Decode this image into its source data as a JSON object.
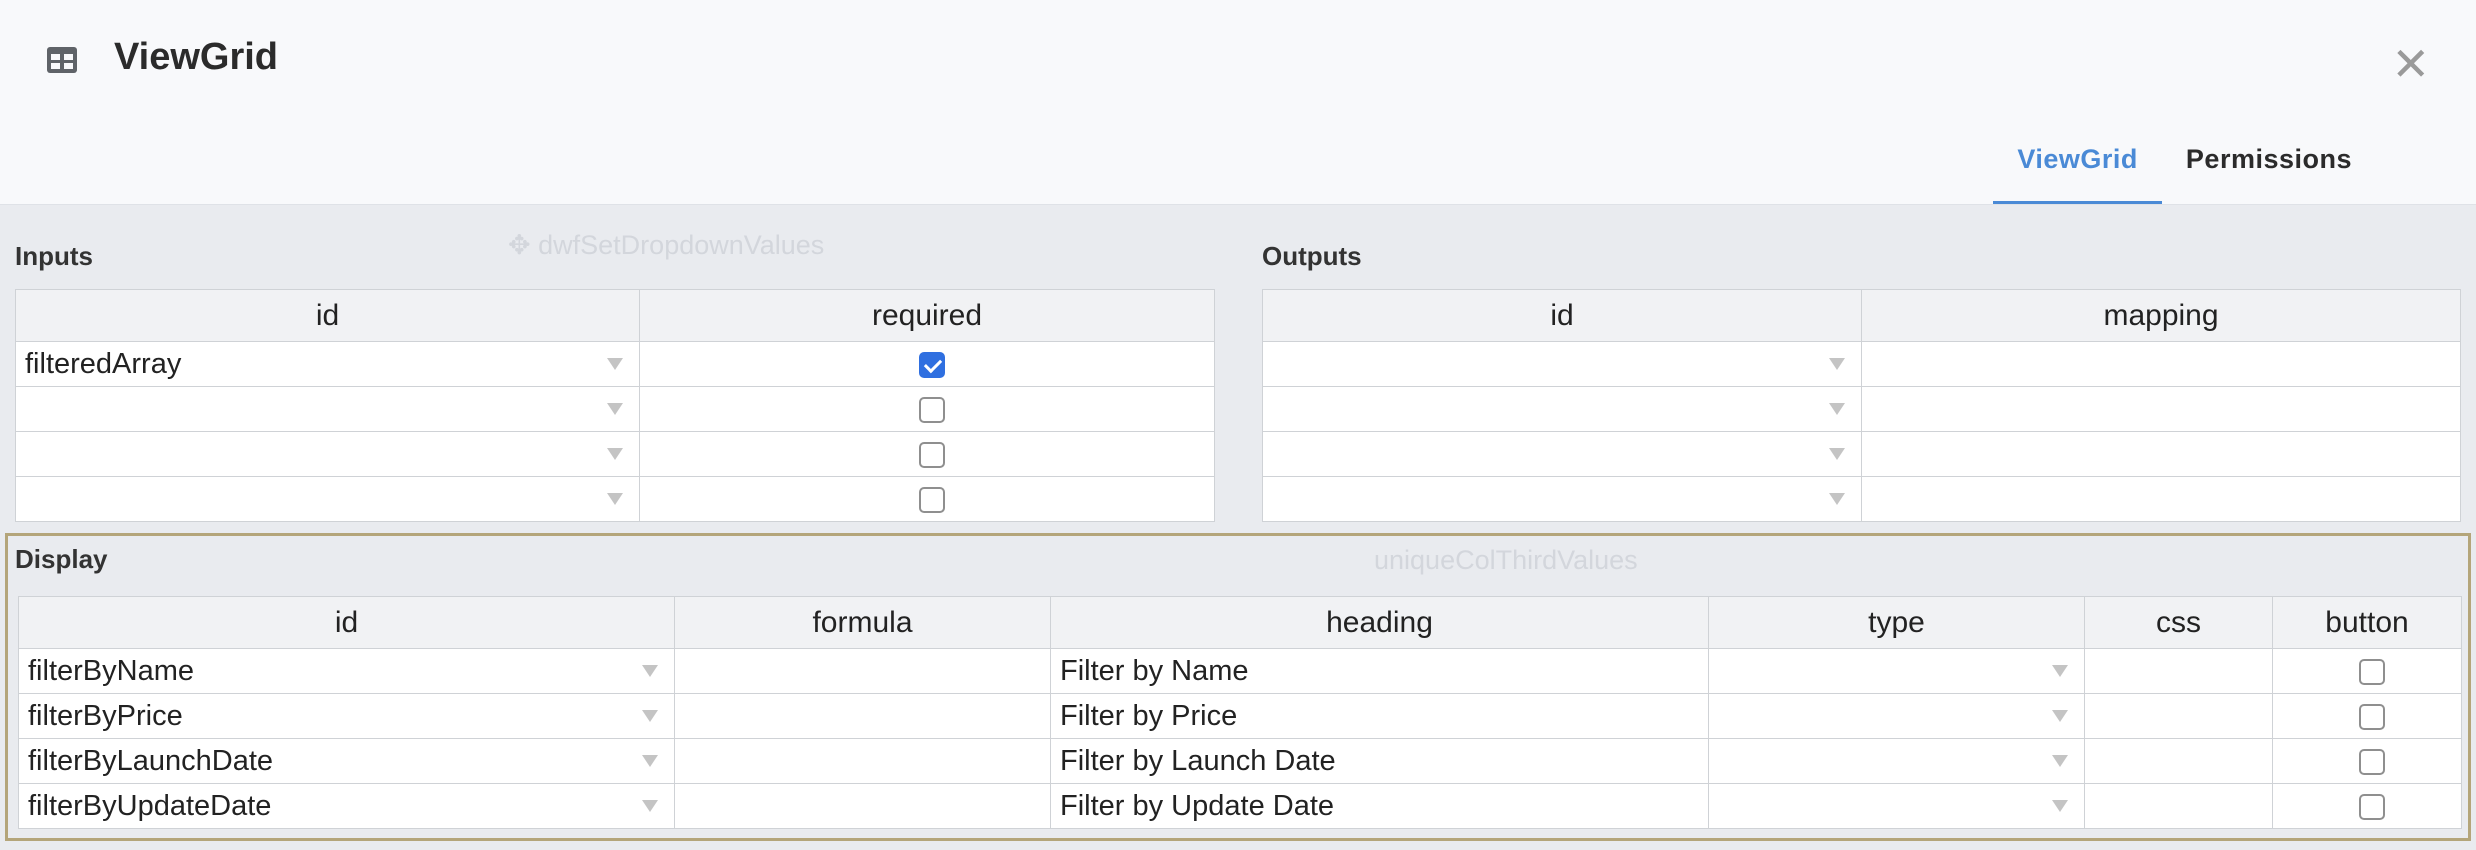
{
  "header": {
    "title": "ViewGrid",
    "title_icon": "table-icon",
    "close_icon": "close-icon",
    "close_glyph": "✕",
    "tabs": [
      {
        "label": "ViewGrid",
        "active": true
      },
      {
        "label": "Permissions",
        "active": false
      }
    ]
  },
  "background_canvas": {
    "node_1": "dwfSetDropdownValues",
    "node_2": "uniqueColThirdValues"
  },
  "inputs": {
    "label": "Inputs",
    "columns": [
      "id",
      "required"
    ],
    "rows": [
      {
        "id": "filteredArray",
        "required": true
      },
      {
        "id": "",
        "required": false
      },
      {
        "id": "",
        "required": false
      },
      {
        "id": "",
        "required": false
      }
    ]
  },
  "outputs": {
    "label": "Outputs",
    "columns": [
      "id",
      "mapping"
    ],
    "rows": [
      {
        "id": "",
        "mapping": ""
      },
      {
        "id": "",
        "mapping": ""
      },
      {
        "id": "",
        "mapping": ""
      },
      {
        "id": "",
        "mapping": ""
      }
    ]
  },
  "display": {
    "label": "Display",
    "columns": [
      "id",
      "formula",
      "heading",
      "type",
      "css",
      "button"
    ],
    "rows": [
      {
        "id": "filterByName",
        "formula": "",
        "heading": "Filter by Name",
        "type": "",
        "css": "",
        "button": false
      },
      {
        "id": "filterByPrice",
        "formula": "",
        "heading": "Filter by Price",
        "type": "",
        "css": "",
        "button": false
      },
      {
        "id": "filterByLaunchDate",
        "formula": "",
        "heading": "Filter by Launch Date",
        "type": "",
        "css": "",
        "button": false
      },
      {
        "id": "filterByUpdateDate",
        "formula": "",
        "heading": "Filter by Update Date",
        "type": "",
        "css": "",
        "button": false
      }
    ]
  },
  "colors": {
    "accent": "#4a8ad6",
    "checkbox_checked": "#2f6fe0",
    "display_border": "#b4a57a"
  }
}
